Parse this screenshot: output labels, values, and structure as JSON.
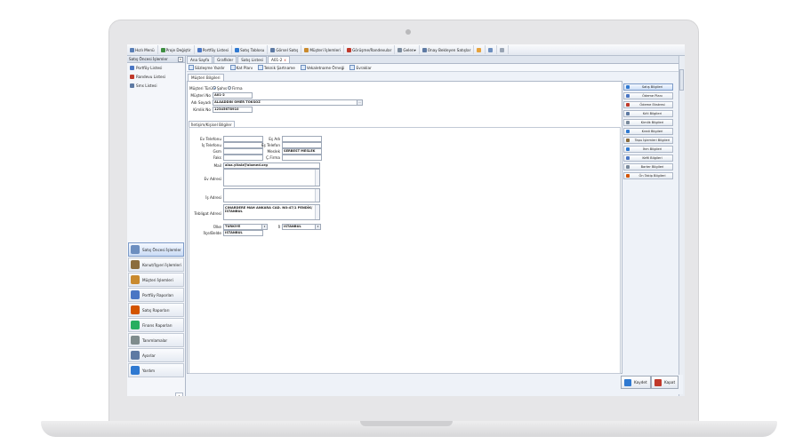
{
  "menubar": {
    "items": [
      {
        "label": "Hızlı Menü",
        "icon": "menu-icon",
        "color": "#5a7fb5"
      },
      {
        "label": "Proje Değiştir",
        "icon": "refresh-icon",
        "color": "#3e8e41"
      },
      {
        "label": "Portföy Listesi",
        "icon": "list-icon",
        "color": "#4a76c4"
      },
      {
        "label": "Satış Tablosu",
        "icon": "table-icon",
        "color": "#2f79d1"
      },
      {
        "label": "Görsel Satış",
        "icon": "grid-icon",
        "color": "#5e7aa3"
      },
      {
        "label": "Müşteri İşlemleri",
        "icon": "users-icon",
        "color": "#c98a2e"
      },
      {
        "label": "Görüşme/Randevular",
        "icon": "calendar-icon",
        "color": "#c0392b"
      },
      {
        "label": "Gelen",
        "icon": "inbox-icon",
        "color": "#7a8a9c"
      },
      {
        "label": "Onay Bekleyen Satışlar",
        "icon": "table-icon",
        "color": "#5e7aa3"
      }
    ],
    "extra_icons": [
      "settings-icon",
      "help-icon",
      "info-icon"
    ]
  },
  "left_panel": {
    "title": "Satış Öncesi İşlemler",
    "collapse": "«",
    "items": [
      {
        "label": "Portföy Listesi",
        "color": "#4a76c4"
      },
      {
        "label": "Randevu Listesi",
        "color": "#c0392b"
      },
      {
        "label": "Sms Listesi",
        "color": "#5e7aa3"
      }
    ],
    "nav_buttons": [
      {
        "label": "Satış Öncesi İşlemler",
        "color": "#6c8ebf",
        "active": true
      },
      {
        "label": "Konut/İşyeri İşlemleri",
        "color": "#8b6d3e",
        "active": false
      },
      {
        "label": "Müşteri İşlemleri",
        "color": "#c98a2e",
        "active": false
      },
      {
        "label": "Portföy Raporları",
        "color": "#4a76c4",
        "active": false
      },
      {
        "label": "Satış Raporları",
        "color": "#d35400",
        "active": false
      },
      {
        "label": "Finans Raporları",
        "color": "#27ae60",
        "active": false
      },
      {
        "label": "Tanımlamalar",
        "color": "#7f8c8d",
        "active": false
      },
      {
        "label": "Ayarlar",
        "color": "#5e7aa3",
        "active": false
      },
      {
        "label": "Yardım",
        "color": "#2f79d1",
        "active": false
      }
    ],
    "bottom_btn": "⇕"
  },
  "tabs": [
    {
      "label": "Ana Sayfa",
      "active": false,
      "close": false
    },
    {
      "label": "Grafikler",
      "active": false,
      "close": false
    },
    {
      "label": "Satış Listesi",
      "active": false,
      "close": false
    },
    {
      "label": "A01-2",
      "active": true,
      "close": true
    }
  ],
  "tab_close": "x",
  "sub_toolbar": [
    {
      "label": "Sözleşme Yazdır"
    },
    {
      "label": "Kat Planı"
    },
    {
      "label": "Teknik Şartname"
    },
    {
      "label": "Vekaletname Örneği"
    },
    {
      "label": "Evraklar"
    }
  ],
  "inner_tab": "Müşteri Bilgileri",
  "form": {
    "musteri_turu_label": "Müşteri Türü",
    "sahis": "Şahıs",
    "firma": "Firma",
    "musteri_no_label": "Müşteri No",
    "musteri_no": "A01-2",
    "adi_soyadi_label": "Adı Soyadı",
    "adi_soyadi": "ALAADDİN ÖMER TOKSÖZ",
    "kimlik_no_label": "Kimlik No",
    "kimlik_no": "12345678910",
    "group_tab": "İletişim/Kişisel Bilgiler",
    "ev_telefonu_label": "Ev Telefonu",
    "is_telefonu_label": "İş Telefonu",
    "gsm_label": "Gsm",
    "faks_label": "Faks",
    "es_adi_label": "Eş Adı",
    "es_telefon_label": "Eş Telefon",
    "meslek_label": "Meslek",
    "meslek": "SERBEST MESLEK",
    "c_firma_label": "Ç.Firma",
    "mail_label": "Mail",
    "mail": "alaa.yiksiz@alomed.org",
    "ev_adresi_label": "Ev Adresi",
    "is_adresi_label": "İş Adresi",
    "tebligat_adresi_label": "Tebligat Adresi",
    "tebligat_adresi": "ÇINARDERE MAH ANKARA CAD. NO:47/1 PENDİK/İSTANBUL",
    "ulke_label": "Ülke",
    "ulke": "TÜRKİYE",
    "il_label": "İl",
    "il": "İSTANBUL",
    "ilce_label": "İlçe/Belde",
    "ilce": "İSTANBUL"
  },
  "right_panel": [
    {
      "label": "Satış Bilgileri",
      "color": "#2f79d1",
      "active": true
    },
    {
      "label": "Ödeme Planı",
      "color": "#4a76c4",
      "active": false
    },
    {
      "label": "Ödeme Ekstresi",
      "color": "#c0392b",
      "active": false
    },
    {
      "label": "Kıfıl Bilgileri",
      "color": "#5e7aa3",
      "active": false
    },
    {
      "label": "Kimlik Bilgileri",
      "color": "#7a8a9c",
      "active": false
    },
    {
      "label": "Kredi Bilgileri",
      "color": "#2f79d1",
      "active": false
    },
    {
      "label": "Tapu İşlemleri Bilgileri",
      "color": "#8b6d3e",
      "active": false
    },
    {
      "label": "İhm Bilgileri",
      "color": "#2f79d1",
      "active": false
    },
    {
      "label": "Kefil Bilgileri",
      "color": "#4a76c4",
      "active": false
    },
    {
      "label": "Barter Bilgileri",
      "color": "#7a8a9c",
      "active": false
    },
    {
      "label": "Ön Takip Bilgileri",
      "color": "#d35400",
      "active": false
    }
  ],
  "actions": {
    "save": "Kaydet",
    "cancel": "Kapat",
    "save_color": "#2f79d1",
    "cancel_color": "#c0392b"
  }
}
